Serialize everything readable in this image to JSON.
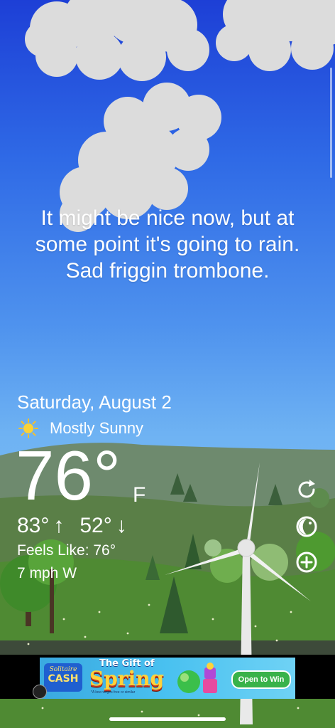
{
  "message": {
    "line1": "It might be nice now, but at",
    "line2": "some point it's going to rain.",
    "line3": "Sad friggin trombone."
  },
  "weather": {
    "date": "Saturday, August 2",
    "condition": "Mostly Sunny",
    "condition_icon": "sun-icon",
    "temperature": "76°",
    "unit": "F",
    "high": "83°",
    "low": "52°",
    "high_arrow": "↑",
    "low_arrow": "↓",
    "feels_like": "Feels Like: 76°",
    "wind": "7 mph W"
  },
  "side_buttons": {
    "refresh_icon": "refresh-icon",
    "moon_icon": "moon-icon",
    "add_icon": "add-location-icon"
  },
  "ad": {
    "brand_top": "Solitaire",
    "brand_bottom": "CASH",
    "headline_top": "The Gift of",
    "headline_main": "Spring",
    "fine_print": "*A low ranges free or similar",
    "cta": "Open to Win",
    "info_icon": "ad-info-icon"
  },
  "colors": {
    "sky_top": "#1d3fd6",
    "sky_bottom": "#7cbef5",
    "grass": "#4f8a33",
    "ad_cta": "#38b24a"
  }
}
